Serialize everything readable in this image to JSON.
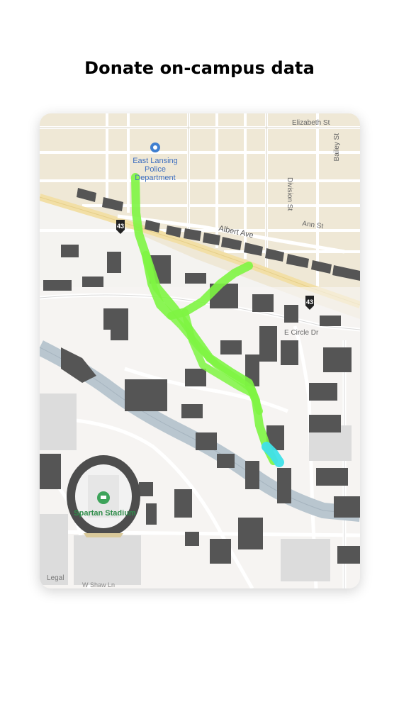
{
  "page": {
    "title": "Donate on-campus data"
  },
  "map": {
    "labels": {
      "police_line1": "East Lansing",
      "police_line2": "Police",
      "police_line3": "Department",
      "elizabeth_st": "Elizabeth St",
      "bailey_st": "Bailey St",
      "division_st": "Division St",
      "albert_ave": "Albert Ave",
      "ann_st": "Ann St",
      "e_circle_dr": "E Circle Dr",
      "route_number": "43",
      "stadium": "Spartan Stadium",
      "legal": "Legal",
      "bottom_street": "W Shaw Ln"
    },
    "colors": {
      "path": "#7ef542",
      "path_end": "#3fe0e8",
      "building": "#555555",
      "road_major": "#f2dfa6",
      "water": "#b9c6cf",
      "campus": "#f6f5f3",
      "town": "#efe8d6"
    },
    "icons": {
      "police": "police-badge-icon",
      "route": "route-shield-icon",
      "stadium": "stadium-icon"
    }
  }
}
